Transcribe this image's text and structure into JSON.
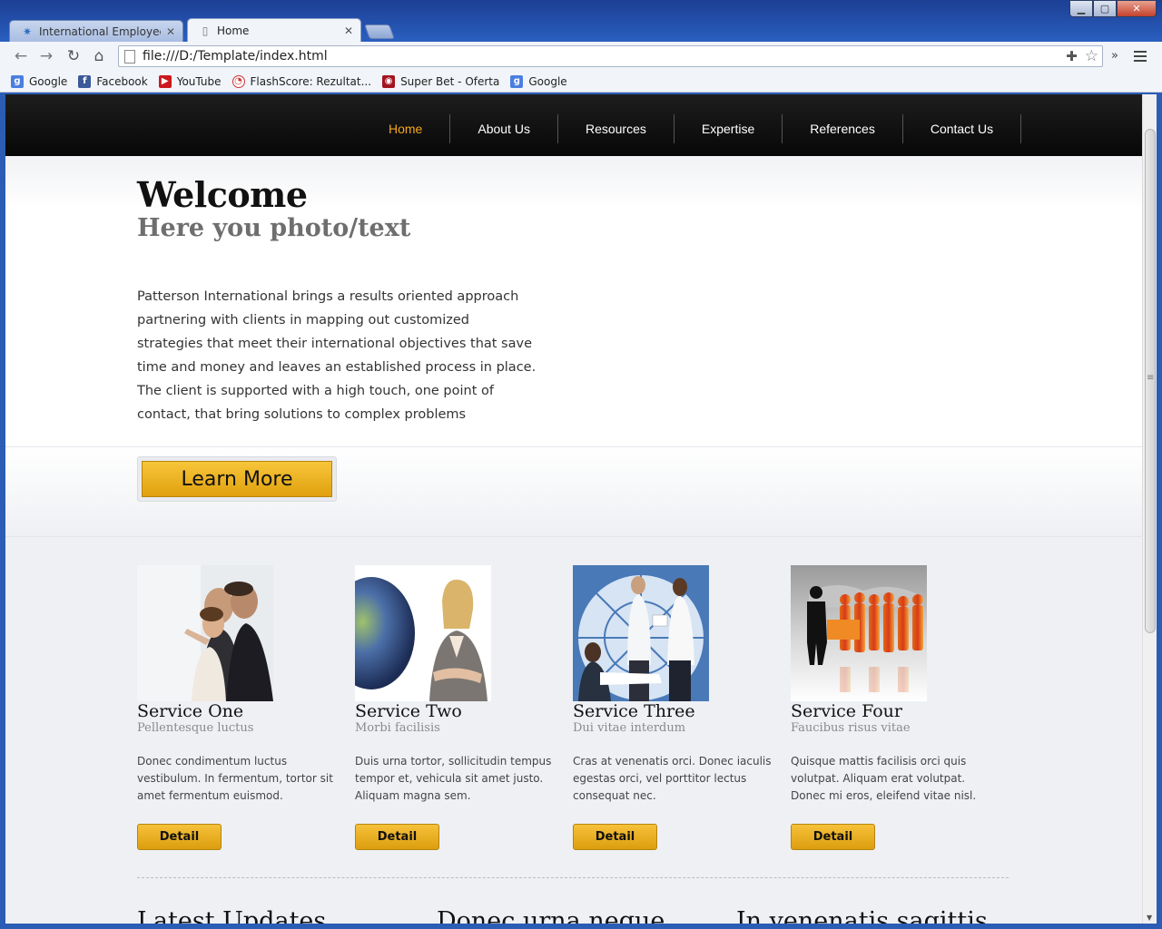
{
  "browser": {
    "tabs": [
      {
        "title": "International Employee Be",
        "active": false
      },
      {
        "title": "Home",
        "active": true
      }
    ],
    "url": "file:///D:/Template/index.html",
    "bookmarks": [
      {
        "label": "Google",
        "icon": "google-icon"
      },
      {
        "label": "Facebook",
        "icon": "facebook-icon"
      },
      {
        "label": "YouTube",
        "icon": "youtube-icon"
      },
      {
        "label": "FlashScore: Rezultat...",
        "icon": "flashscore-icon"
      },
      {
        "label": "Super Bet - Oferta",
        "icon": "superbet-icon"
      },
      {
        "label": "Google",
        "icon": "google-icon"
      }
    ]
  },
  "site": {
    "nav": [
      "Home",
      "About Us",
      "Resources",
      "Expertise",
      "References",
      "Contact Us"
    ],
    "current_nav": "Home",
    "accent_color": "#f5a623",
    "hero": {
      "title": "Welcome",
      "subtitle": "Here you photo/text",
      "intro": "Patterson International brings a results oriented approach partnering with clients in mapping out customized strategies that meet their international objectives that save time and money and leaves an established process in place. The client is supported with a high touch, one point of contact, that bring solutions to complex problems"
    },
    "cta_label": "Learn More",
    "services": [
      {
        "title": "Service One",
        "subtitle": "Pellentesque luctus",
        "desc": "Donec condimentum luctus vestibulum. In fermentum, tortor sit amet fermentum euismod.",
        "button": "Detail"
      },
      {
        "title": "Service Two",
        "subtitle": "Morbi facilisis",
        "desc": "Duis urna tortor, sollicitudin tempus tempor et, vehicula sit amet justo. Aliquam magna sem.",
        "button": "Detail"
      },
      {
        "title": "Service Three",
        "subtitle": "Dui vitae interdum",
        "desc": "Cras at venenatis orci. Donec iaculis egestas orci, vel porttitor lectus consequat nec.",
        "button": "Detail"
      },
      {
        "title": "Service Four",
        "subtitle": "Faucibus risus vitae",
        "desc": "Quisque mattis facilisis orci quis volutpat. Aliquam erat volutpat. Donec mi eros, eleifend vitae nisl.",
        "button": "Detail"
      }
    ],
    "bottom_headings": [
      "Latest Updates",
      "Donec urna neque",
      "In venenatis sagittis"
    ]
  }
}
